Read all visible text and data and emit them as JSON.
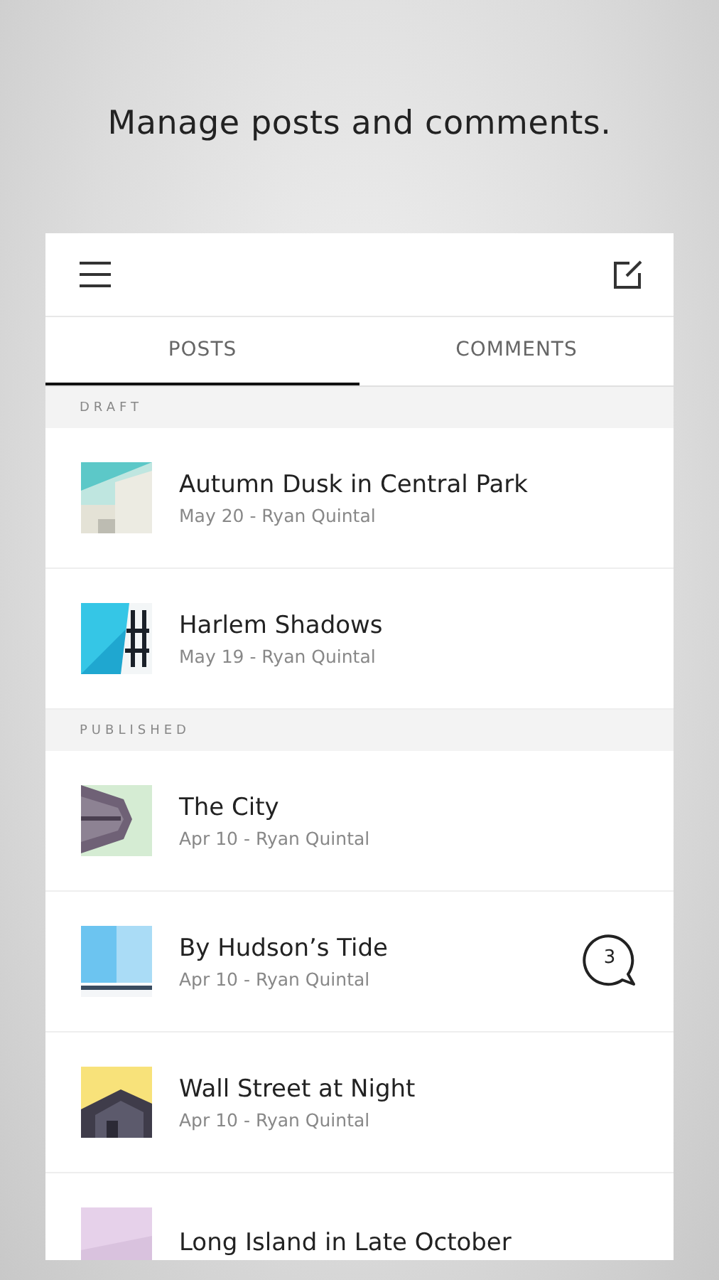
{
  "headline": "Manage posts and comments.",
  "tabs": [
    {
      "label": "POSTS",
      "selected": true
    },
    {
      "label": "COMMENTS",
      "selected": false
    }
  ],
  "sections": [
    {
      "label": "DRAFT",
      "posts": [
        {
          "title": "Autumn Dusk in Central Park",
          "meta": "May 20 - Ryan Quintal"
        },
        {
          "title": "Harlem Shadows",
          "meta": "May 19 - Ryan Quintal"
        }
      ]
    },
    {
      "label": "PUBLISHED",
      "posts": [
        {
          "title": "The City",
          "meta": "Apr 10 - Ryan Quintal"
        },
        {
          "title": "By Hudson’s Tide",
          "meta": "Apr 10 - Ryan Quintal",
          "comments": "3"
        },
        {
          "title": "Wall Street at Night",
          "meta": "Apr 10 - Ryan Quintal"
        },
        {
          "title": "Long Island in Late October"
        }
      ]
    }
  ]
}
